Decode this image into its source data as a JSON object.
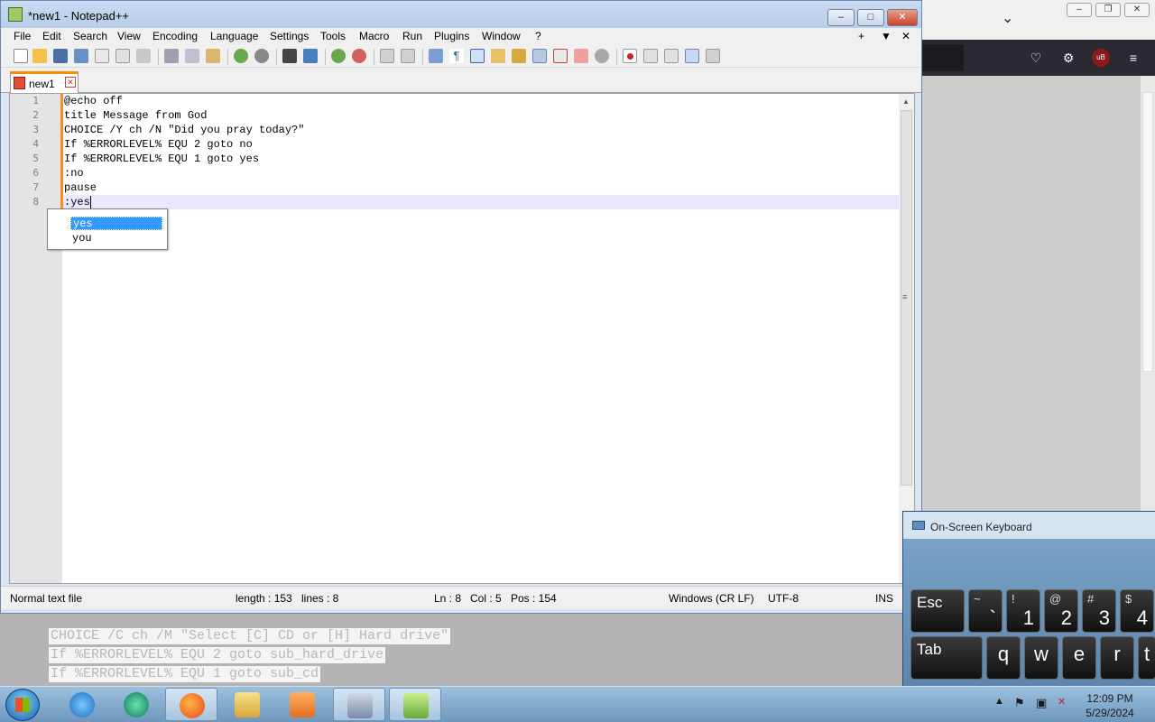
{
  "browser": {
    "chevron": "⌄",
    "window_buttons": [
      "–",
      "❐",
      "✕"
    ],
    "toolbar_icons": [
      "pocket-icon",
      "extensions-icon",
      "ublock-icon",
      "menu-icon"
    ],
    "ublock_label": "uB"
  },
  "npp": {
    "title": "*new1 - Notepad++",
    "caption": {
      "minimize": "–",
      "maximize": "□",
      "close": "✕"
    },
    "menu": [
      "File",
      "Edit",
      "Search",
      "View",
      "Encoding",
      "Language",
      "Settings",
      "Tools",
      "Macro",
      "Run",
      "Plugins",
      "Window",
      "?"
    ],
    "menu_right": [
      "+",
      "▼",
      "✕"
    ],
    "tab": {
      "label": "new1",
      "close": "✕"
    },
    "lines": [
      {
        "num": "1",
        "text": "@echo off"
      },
      {
        "num": "2",
        "text": "title Message from God"
      },
      {
        "num": "3",
        "text": "CHOICE /Y ch /N \"Did you pray today?\""
      },
      {
        "num": "4",
        "text": "If %ERRORLEVEL% EQU 2 goto no"
      },
      {
        "num": "5",
        "text": "If %ERRORLEVEL% EQU 1 goto yes"
      },
      {
        "num": "6",
        "text": ":no"
      },
      {
        "num": "7",
        "text": "pause"
      },
      {
        "num": "8",
        "text": ":yes"
      }
    ],
    "autocomplete": [
      "yes",
      "you"
    ],
    "autocomplete_selected": 0,
    "scroll_up": "▲",
    "scroll_down": "▼",
    "scroll_grip": "≡",
    "status": {
      "type": "Normal text file",
      "length": "length : 153",
      "lines": "lines : 8",
      "ln": "Ln : 8",
      "col": "Col : 5",
      "pos": "Pos : 154",
      "eol": "Windows (CR LF)",
      "encoding": "UTF-8",
      "mode": "INS"
    }
  },
  "background_text": [
    "CHOICE /C ch /M \"Select [C] CD or [H] Hard drive\"",
    "If %ERRORLEVEL% EQU 2 goto sub_hard_drive",
    "If %ERRORLEVEL% EQU 1 goto sub_cd"
  ],
  "osk": {
    "title": "On-Screen Keyboard",
    "keys_row1": [
      {
        "label": "Esc"
      },
      {
        "top": "~",
        "bottom": "`"
      },
      {
        "top": "!",
        "bottom": "1"
      },
      {
        "top": "@",
        "bottom": "2"
      },
      {
        "top": "#",
        "bottom": "3"
      },
      {
        "top": "$",
        "bottom": "4"
      }
    ],
    "keys_row2": [
      "Tab",
      "q",
      "w",
      "e",
      "r",
      "t"
    ]
  },
  "taskbar": {
    "apps": [
      "internet-explorer-icon",
      "app-green-icon",
      "firefox-icon",
      "file-explorer-icon",
      "media-player-icon",
      "osk-app-icon",
      "notepadpp-app-icon"
    ],
    "tray": [
      "▲",
      "⚑",
      "▣",
      "✕"
    ],
    "time": "12:09 PM",
    "date": "5/29/2024"
  }
}
